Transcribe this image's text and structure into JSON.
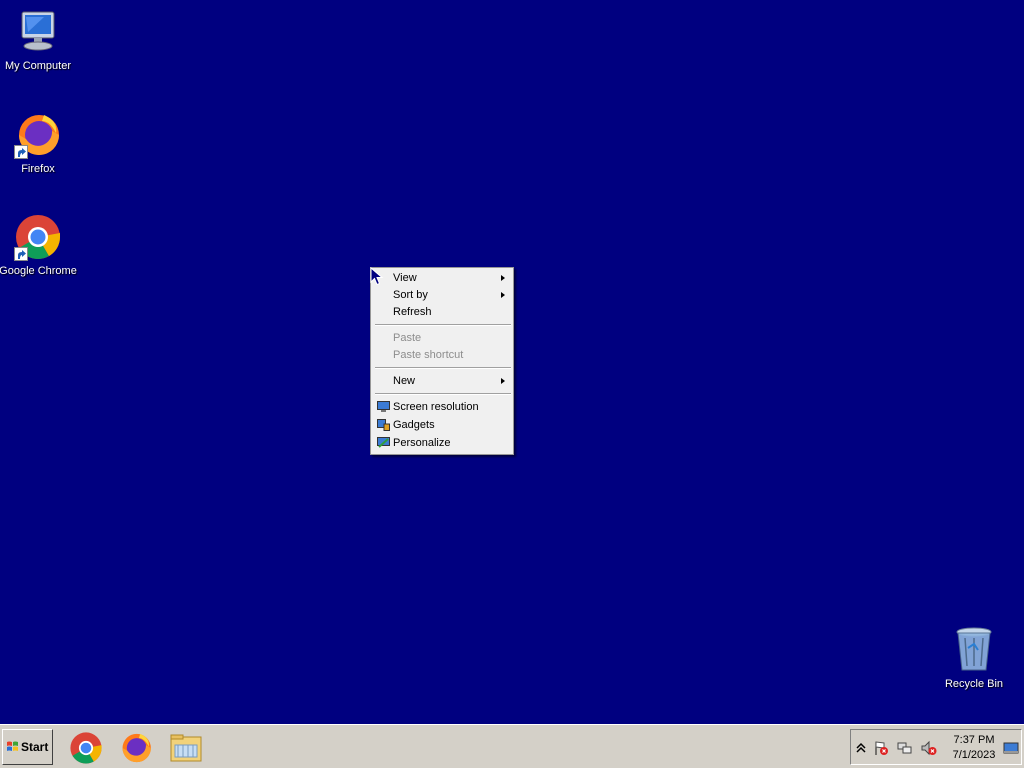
{
  "desktop": {
    "background": "#000080",
    "icons": [
      {
        "label": "My Computer",
        "icon": "computer-icon"
      },
      {
        "label": "Firefox",
        "icon": "firefox-icon"
      },
      {
        "label": "Google Chrome",
        "icon": "chrome-icon"
      },
      {
        "label": "Recycle Bin",
        "icon": "recycle-bin-icon"
      }
    ]
  },
  "context_menu": {
    "items": [
      {
        "label": "View",
        "submenu": true,
        "disabled": false
      },
      {
        "label": "Sort by",
        "submenu": true,
        "disabled": false
      },
      {
        "label": "Refresh",
        "submenu": false,
        "disabled": false
      },
      {
        "label": "Paste",
        "submenu": false,
        "disabled": true
      },
      {
        "label": "Paste shortcut",
        "submenu": false,
        "disabled": true
      },
      {
        "label": "New",
        "submenu": true,
        "disabled": false
      },
      {
        "label": "Screen resolution",
        "icon": "screen-resolution-icon",
        "disabled": false
      },
      {
        "label": "Gadgets",
        "icon": "gadgets-icon",
        "disabled": false
      },
      {
        "label": "Personalize",
        "icon": "personalize-icon",
        "disabled": false
      }
    ]
  },
  "taskbar": {
    "start_label": "Start",
    "pinned": [
      "chrome-icon",
      "firefox-icon",
      "file-explorer-icon"
    ],
    "tray": {
      "icons": [
        "show-hidden-icons-icon",
        "action-center-flag-icon",
        "network-icon",
        "volume-muted-icon"
      ],
      "time": "7:37 PM",
      "date": "7/1/2023"
    }
  }
}
